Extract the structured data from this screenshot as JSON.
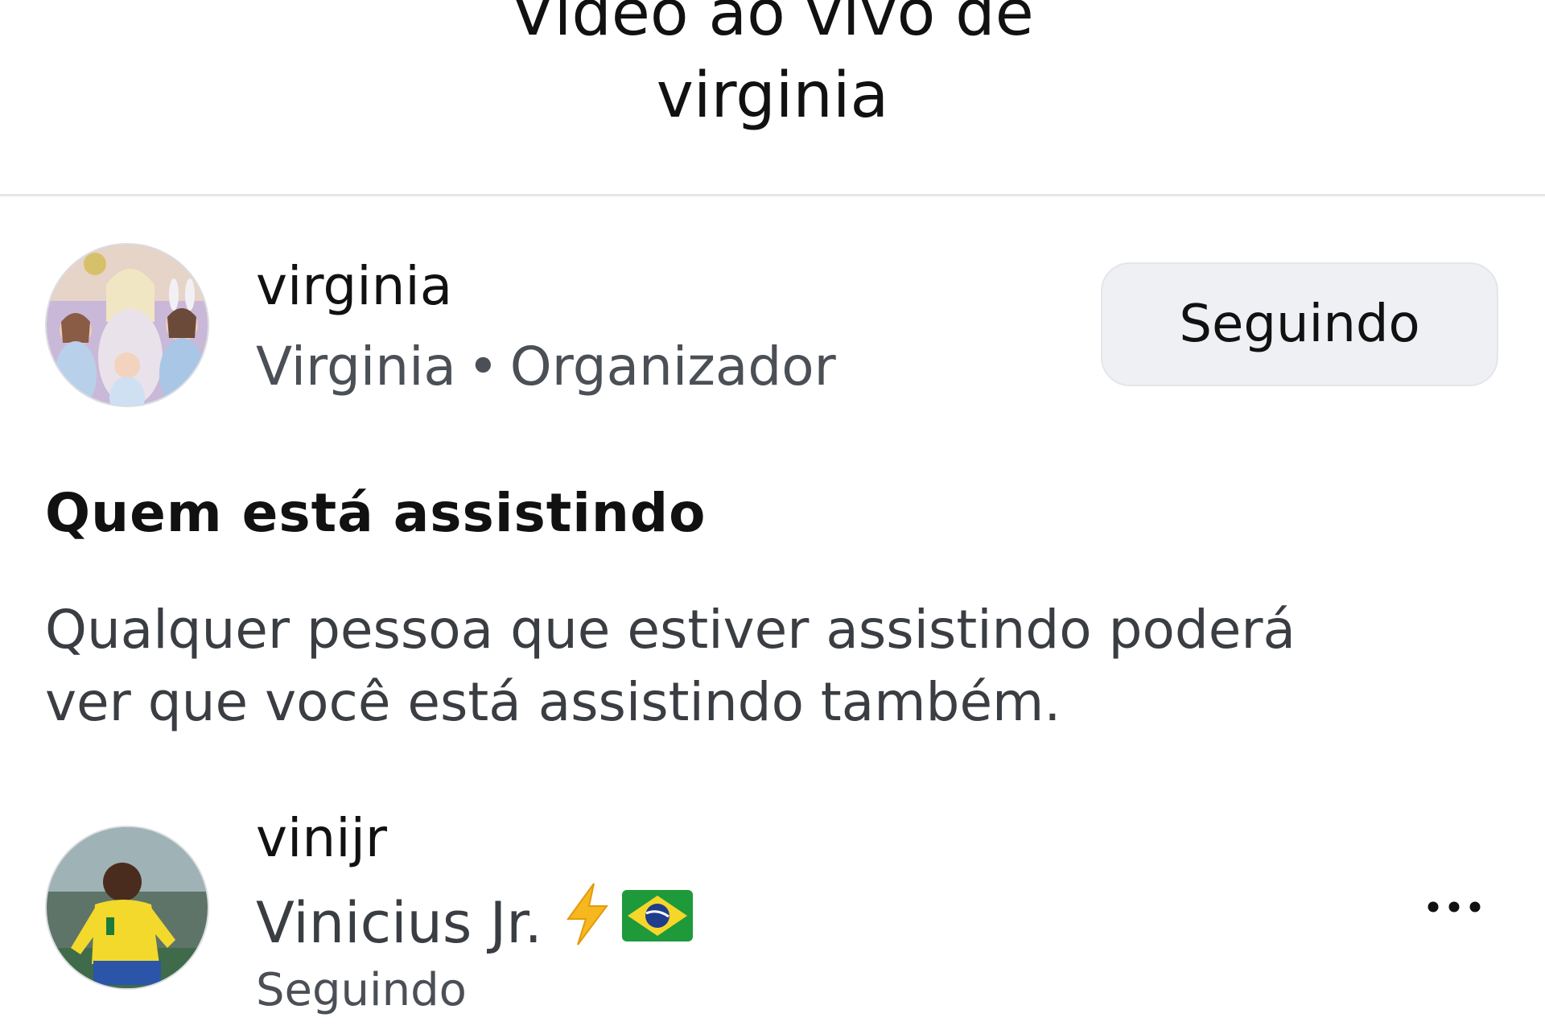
{
  "header": {
    "title_line1": "Vídeo ao vivo de",
    "title_line2": "virginia"
  },
  "host": {
    "username": "virginia",
    "display_name": "Virginia",
    "separator": "•",
    "role": "Organizador",
    "follow_button_label": "Seguindo",
    "avatar_icon": "avatar-photo"
  },
  "watching": {
    "heading": "Quem está assistindo",
    "description_line1": "Qualquer pessoa que estiver assistindo poderá",
    "description_line2": "ver que você está assistindo também."
  },
  "viewers": [
    {
      "username": "vinijr",
      "display_name": "Vinicius Jr.",
      "emojis": [
        "lightning-bolt-icon",
        "brazil-flag-icon"
      ],
      "status": "Seguindo",
      "more_icon": "more-options-icon"
    }
  ],
  "colors": {
    "follow_button_bg": "#eef0f3",
    "secondary_text": "#4b4f56",
    "divider": "#e4e6e9"
  }
}
